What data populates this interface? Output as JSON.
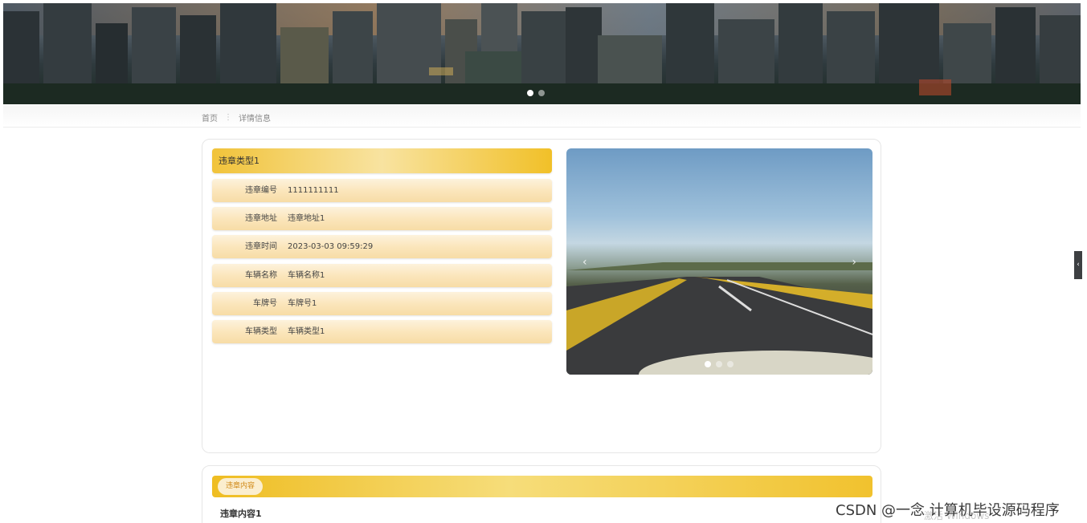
{
  "banner": {
    "carousel_dots": 2,
    "active_dot": 0
  },
  "breadcrumb": {
    "home": "首页",
    "separator": "⋮",
    "current": "详情信息"
  },
  "detail": {
    "title": "违章类型1",
    "fields": [
      {
        "label": "违章编号",
        "value": "1111111111"
      },
      {
        "label": "违章地址",
        "value": "违章地址1"
      },
      {
        "label": "违章时间",
        "value": "2023-03-03 09:59:29"
      },
      {
        "label": "车辆名称",
        "value": "车辆名称1"
      },
      {
        "label": "车牌号",
        "value": "车牌号1"
      },
      {
        "label": "车辆类型",
        "value": "车辆类型1"
      }
    ],
    "carousel": {
      "prev_label": "‹",
      "next_label": "›",
      "dots": 3,
      "active_dot": 0
    }
  },
  "content_section": {
    "tab_label": "违章内容",
    "text": "违章内容1"
  },
  "side_tab": {
    "label": "‹"
  },
  "watermark": {
    "text": "CSDN @一念 计算机毕设源码程序",
    "ghost": "激活 Windows"
  },
  "colors": {
    "accent": "#f1c33a",
    "row_bg": "#fbe6bc",
    "tab_text": "#d08a18"
  }
}
